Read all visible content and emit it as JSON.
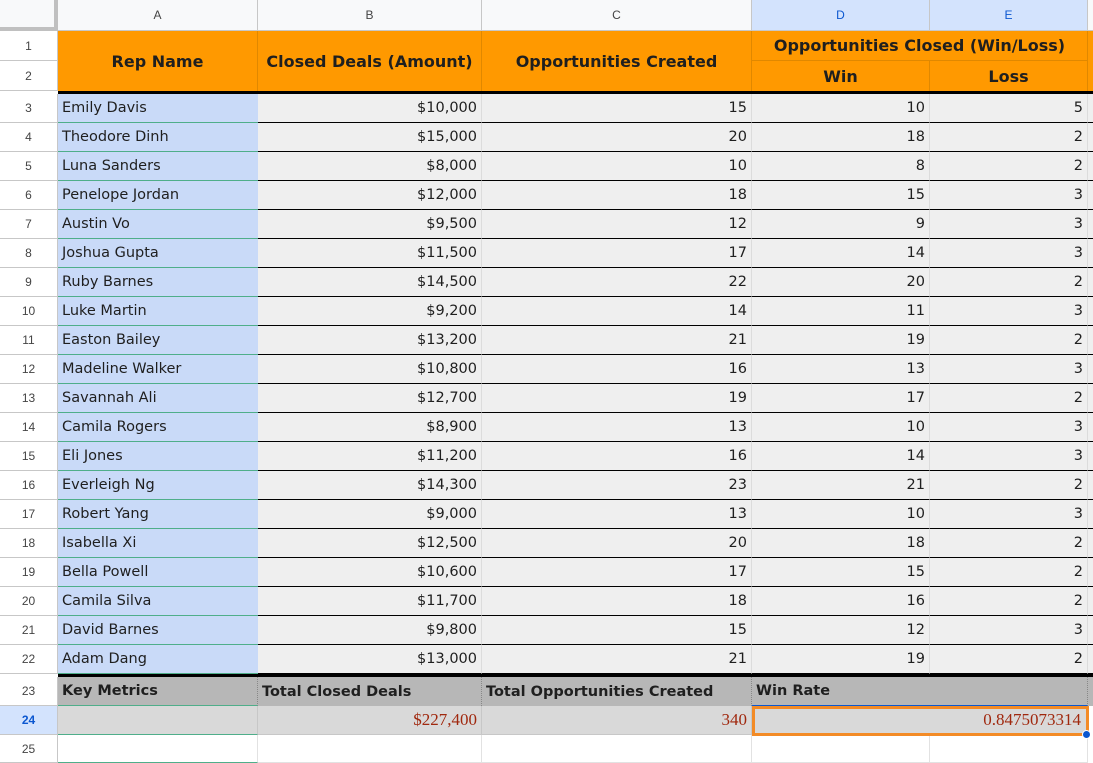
{
  "sheet": {
    "column_headers": [
      "A",
      "B",
      "C",
      "D",
      "E"
    ],
    "selected_columns": [
      "D",
      "E"
    ],
    "row_numbers": [
      "1",
      "2",
      "3",
      "4",
      "5",
      "6",
      "7",
      "8",
      "9",
      "10",
      "11",
      "12",
      "13",
      "14",
      "15",
      "16",
      "17",
      "18",
      "19",
      "20",
      "21",
      "22",
      "23",
      "24",
      "25"
    ],
    "selected_row": "24"
  },
  "header": {
    "rep_name": "Rep Name",
    "closed_deals": "Closed Deals (Amount)",
    "opportunities_created": "Opportunities Created",
    "opportunities_closed": "Opportunities Closed (Win/Loss)",
    "win": "Win",
    "loss": "Loss"
  },
  "rows": [
    {
      "name": "Emily Davis",
      "amount": "$10,000",
      "created": "15",
      "win": "10",
      "loss": "5"
    },
    {
      "name": "Theodore Dinh",
      "amount": "$15,000",
      "created": "20",
      "win": "18",
      "loss": "2"
    },
    {
      "name": "Luna Sanders",
      "amount": "$8,000",
      "created": "10",
      "win": "8",
      "loss": "2"
    },
    {
      "name": "Penelope Jordan",
      "amount": "$12,000",
      "created": "18",
      "win": "15",
      "loss": "3"
    },
    {
      "name": "Austin Vo",
      "amount": "$9,500",
      "created": "12",
      "win": "9",
      "loss": "3"
    },
    {
      "name": "Joshua Gupta",
      "amount": "$11,500",
      "created": "17",
      "win": "14",
      "loss": "3"
    },
    {
      "name": "Ruby Barnes",
      "amount": "$14,500",
      "created": "22",
      "win": "20",
      "loss": "2"
    },
    {
      "name": "Luke Martin",
      "amount": "$9,200",
      "created": "14",
      "win": "11",
      "loss": "3"
    },
    {
      "name": "Easton Bailey",
      "amount": "$13,200",
      "created": "21",
      "win": "19",
      "loss": "2"
    },
    {
      "name": "Madeline Walker",
      "amount": "$10,800",
      "created": "16",
      "win": "13",
      "loss": "3"
    },
    {
      "name": "Savannah Ali",
      "amount": "$12,700",
      "created": "19",
      "win": "17",
      "loss": "2"
    },
    {
      "name": "Camila Rogers",
      "amount": "$8,900",
      "created": "13",
      "win": "10",
      "loss": "3"
    },
    {
      "name": "Eli Jones",
      "amount": "$11,200",
      "created": "16",
      "win": "14",
      "loss": "3"
    },
    {
      "name": "Everleigh Ng",
      "amount": "$14,300",
      "created": "23",
      "win": "21",
      "loss": "2"
    },
    {
      "name": "Robert Yang",
      "amount": "$9,000",
      "created": "13",
      "win": "10",
      "loss": "3"
    },
    {
      "name": "Isabella Xi",
      "amount": "$12,500",
      "created": "20",
      "win": "18",
      "loss": "2"
    },
    {
      "name": "Bella Powell",
      "amount": "$10,600",
      "created": "17",
      "win": "15",
      "loss": "2"
    },
    {
      "name": "Camila Silva",
      "amount": "$11,700",
      "created": "18",
      "win": "16",
      "loss": "2"
    },
    {
      "name": "David Barnes",
      "amount": "$9,800",
      "created": "15",
      "win": "12",
      "loss": "3"
    },
    {
      "name": "Adam Dang",
      "amount": "$13,000",
      "created": "21",
      "win": "19",
      "loss": "2"
    }
  ],
  "metrics": {
    "key_metrics_label": "Key Metrics",
    "total_closed_deals_label": "Total Closed Deals",
    "total_opportunities_label": "Total Opportunities Created",
    "win_rate_label": "Win Rate",
    "total_closed_deals_value": "$227,400",
    "total_opportunities_value": "340",
    "win_rate_value": "0.8475073314"
  },
  "colors": {
    "header_orange": "#ff9900",
    "name_column_blue": "#c9daf8",
    "metric_value_red": "#a0280e",
    "selection_orange": "#f38b26",
    "selected_header_blue": "#d3e3fd"
  }
}
